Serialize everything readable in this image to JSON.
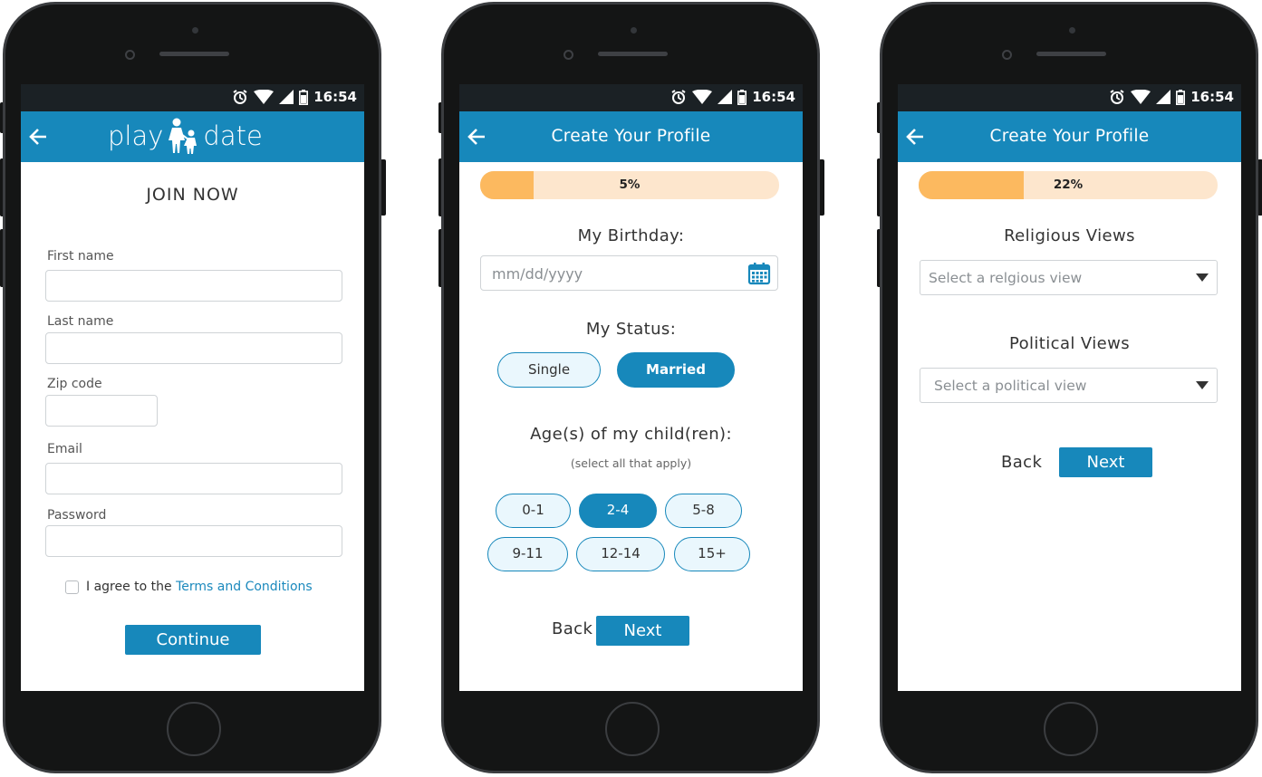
{
  "status": {
    "time": "16:54"
  },
  "screen1": {
    "logo_left": "play",
    "logo_right": "date",
    "heading": "JOIN NOW",
    "fields": {
      "first_name": "First name",
      "last_name": "Last name",
      "zip": "Zip code",
      "email": "Email",
      "password": "Password"
    },
    "agree_prefix": "I agree to the ",
    "agree_link": "Terms and Conditions",
    "continue": "Continue"
  },
  "screen2": {
    "title": "Create Your Profile",
    "progress_label": "5%",
    "progress_value": 0.18,
    "birthday_label": "My Birthday:",
    "birthday_placeholder": "mm/dd/yyyy",
    "status_label": "My Status:",
    "status_options": [
      "Single",
      "Married"
    ],
    "status_selected": "Married",
    "ages_label": "Age(s) of my child(ren):",
    "ages_note": "(select all that apply)",
    "ages": [
      "0-1",
      "2-4",
      "5-8",
      "9-11",
      "12-14",
      "15+"
    ],
    "ages_selected": [
      "2-4"
    ],
    "back": "Back",
    "next": "Next"
  },
  "screen3": {
    "title": "Create Your Profile",
    "progress_label": "22%",
    "progress_value": 0.35,
    "religious_label": "Religious Views",
    "religious_placeholder": "Select a relgious view",
    "political_label": "Political Views",
    "political_placeholder": "Select a political view",
    "back": "Back",
    "next": "Next"
  },
  "colors": {
    "primary": "#1788bb",
    "progress_fill": "#fcb95f",
    "progress_track": "#fde6cd",
    "phone_body": "#141515"
  }
}
